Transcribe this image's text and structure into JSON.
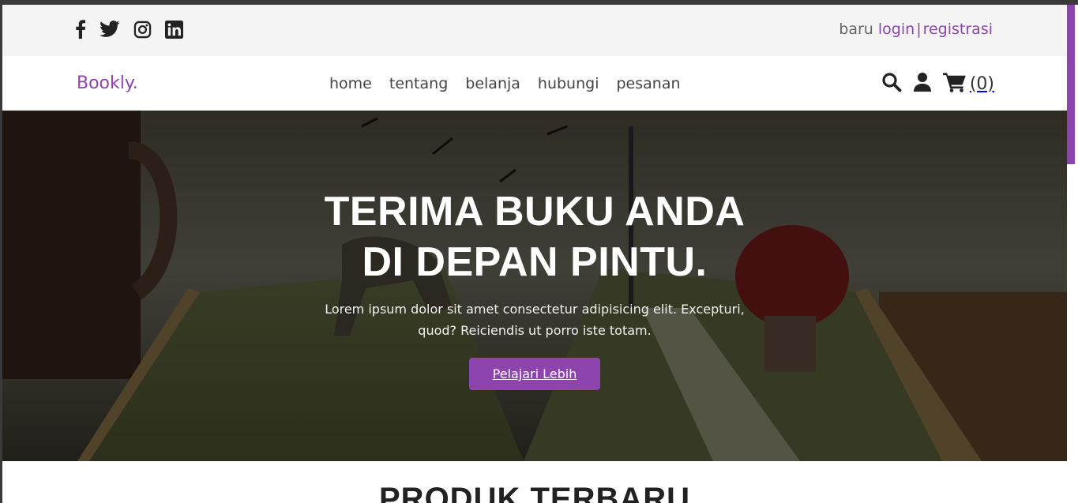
{
  "colors": {
    "accent": "#8e44ad",
    "text_dark": "#333333",
    "header_bg": "#f4f4f4"
  },
  "header1": {
    "socials": [
      {
        "name": "facebook-icon"
      },
      {
        "name": "twitter-icon"
      },
      {
        "name": "instagram-icon"
      },
      {
        "name": "linkedin-icon"
      }
    ],
    "prefix": "baru",
    "login": "login",
    "separator": "|",
    "register": "registrasi"
  },
  "header2": {
    "logo": "Bookly.",
    "nav": [
      "home",
      "tentang",
      "belanja",
      "hubungi",
      "pesanan"
    ],
    "icons": [
      "search-icon",
      "user-icon",
      "cart-icon"
    ],
    "cart_count": "(0)"
  },
  "hero": {
    "title_line1": "TERIMA BUKU ANDA",
    "title_line2": "DI DEPAN PINTU.",
    "text_line1": "Lorem ipsum dolor sit amet consectetur adipisicing elit. Excepturi,",
    "text_line2": "quod? Reiciendis ut porro iste totam.",
    "button": "Pelajari Lebih"
  },
  "products": {
    "title": "PRODUK TERBARU"
  }
}
